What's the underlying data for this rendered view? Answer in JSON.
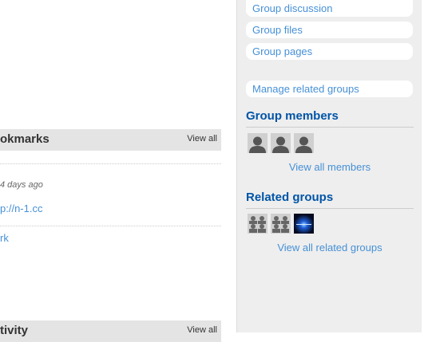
{
  "menu": {
    "discussion": "Group discussion",
    "files": "Group files",
    "pages": "Group pages",
    "manage_related": "Manage related groups"
  },
  "members": {
    "heading": "Group members",
    "view_all": "View all members",
    "avatars": [
      "default-user-icon",
      "default-user-icon",
      "default-user-icon"
    ]
  },
  "related": {
    "heading": "Related groups",
    "view_all": "View all related groups",
    "avatars": [
      "default-group-icon",
      "default-group-icon",
      "group-image-blue"
    ]
  },
  "bookmarks": {
    "title": "okmarks",
    "view_all": "View all",
    "meta": "4 days ago",
    "link": "p://n-1.cc",
    "extra_link": "rk"
  },
  "activity": {
    "title": "tivity",
    "view_all": "View all"
  },
  "colors": {
    "link": "#4690d6",
    "heading": "#0054a7",
    "sidebar_bg": "#eeeeee"
  }
}
